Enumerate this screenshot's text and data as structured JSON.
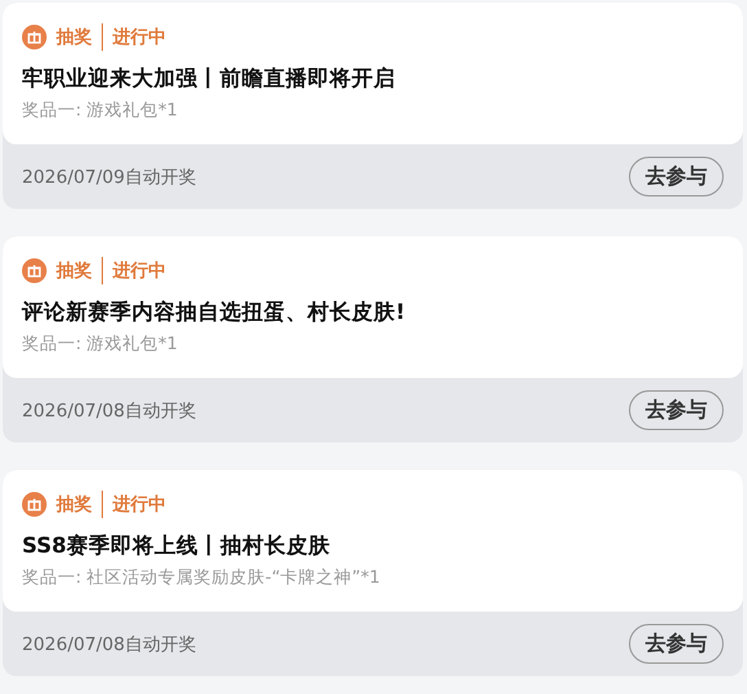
{
  "cards": [
    {
      "tag": "抽奖",
      "status": "进行中",
      "title": "牢职业迎来大加强丨前瞻直播即将开启",
      "prize": "奖品一: 游戏礼包*1",
      "draw_date": "2026/07/09自动开奖",
      "button": "去参与"
    },
    {
      "tag": "抽奖",
      "status": "进行中",
      "title": "评论新赛季内容抽自选扭蛋、村长皮肤!",
      "prize": "奖品一: 游戏礼包*1",
      "draw_date": "2026/07/08自动开奖",
      "button": "去参与"
    },
    {
      "tag": "抽奖",
      "status": "进行中",
      "title": "SS8赛季即将上线丨抽村长皮肤",
      "prize": "奖品一: 社区活动专属奖励皮肤-“卡牌之神”*1",
      "draw_date": "2026/07/08自动开奖",
      "button": "去参与"
    }
  ]
}
